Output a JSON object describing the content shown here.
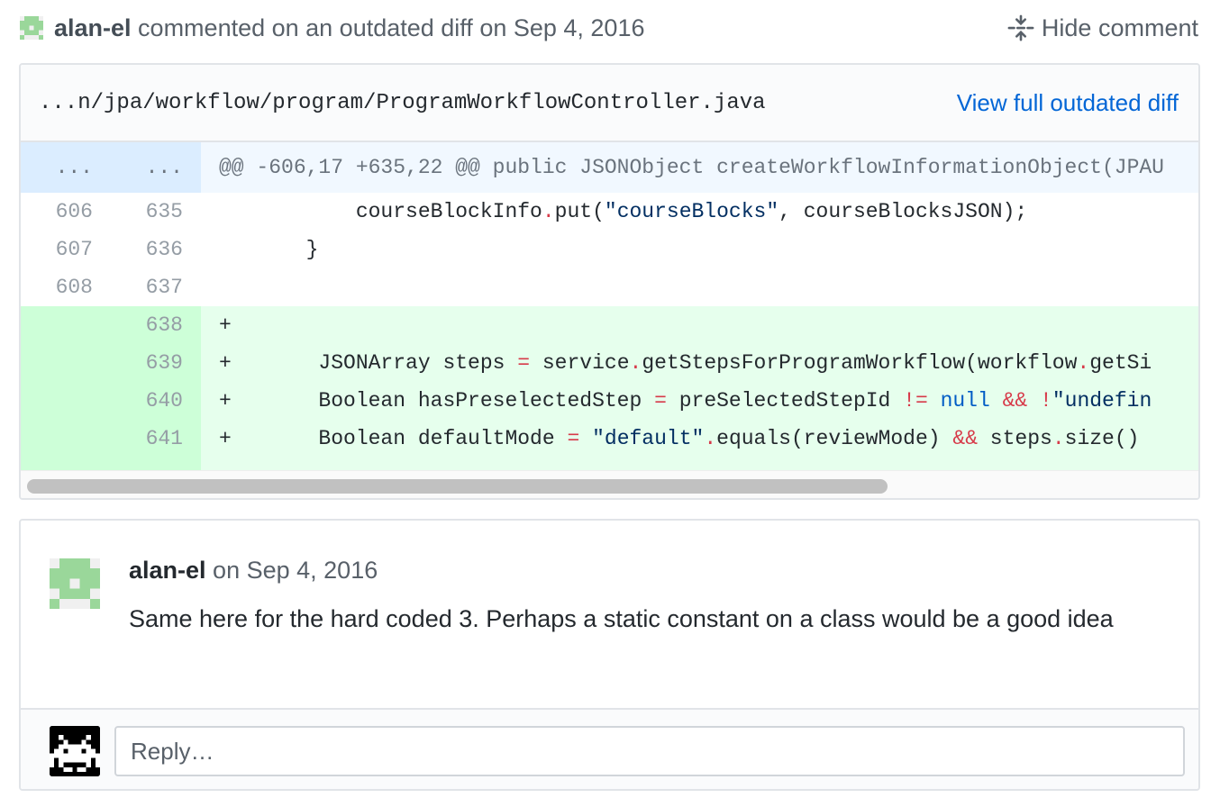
{
  "header": {
    "author": "alan-el",
    "action": " commented on an outdated diff on ",
    "date": "Sep 4, 2016",
    "hide_label": "Hide comment"
  },
  "file": {
    "path": "...n/jpa/workflow/program/ProgramWorkflowController.java",
    "view_link": "View full outdated diff"
  },
  "diff": {
    "hunk": {
      "old": "...",
      "new": "...",
      "text": "@@ -606,17 +635,22 @@ public JSONObject createWorkflowInformationObject(JPAU"
    },
    "rows": [
      {
        "old": "606",
        "new": "635",
        "type": "context"
      },
      {
        "old": "607",
        "new": "636",
        "type": "context"
      },
      {
        "old": "608",
        "new": "637",
        "type": "context"
      },
      {
        "old": "",
        "new": "638",
        "type": "add"
      },
      {
        "old": "",
        "new": "639",
        "type": "add"
      },
      {
        "old": "",
        "new": "640",
        "type": "add"
      },
      {
        "old": "",
        "new": "641",
        "type": "add"
      }
    ]
  },
  "comment": {
    "author": "alan-el",
    "on": " on ",
    "date": "Sep 4, 2016",
    "body": "Same here for the hard coded 3. Perhaps a static constant on a class would be a good idea"
  },
  "reply": {
    "placeholder": "Reply…"
  },
  "colors": {
    "link": "#0366d6",
    "addition_bg": "#e6ffed",
    "addition_gutter": "#cdffd8",
    "hunk_bg": "#f1f8ff",
    "operator": "#d73a49",
    "string": "#032f62",
    "keyword": "#005cc5"
  }
}
